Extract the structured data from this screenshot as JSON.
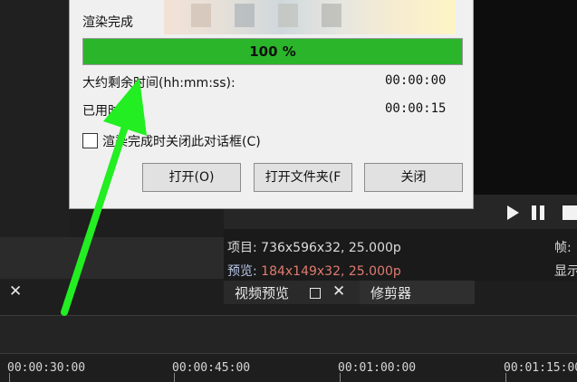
{
  "dialog": {
    "title": "渲染完成",
    "progress_percent": 100,
    "progress_text": "100 %",
    "remaining_label": "大约剩余时间(hh:mm:ss):",
    "remaining_value": "00:00:00",
    "elapsed_label": "已用时间",
    "elapsed_value": "00:00:15",
    "close_on_finish_label": "渲染完成时关闭此对话框(C)",
    "close_on_finish_checked": false,
    "buttons": {
      "open": "打开(O)",
      "open_folder": "打开文件夹(F",
      "close": "关闭"
    }
  },
  "preview": {
    "project_label": "项目:",
    "project_value": "736x596x32, 25.000p",
    "preview_label": "预览:",
    "preview_value": "184x149x32, 25.000p",
    "right_label_1": "帧:",
    "right_label_2": "显示"
  },
  "tabs": {
    "video_preview": "视频预览",
    "trimmer": "修剪器"
  },
  "timeline": {
    "ticks": [
      "00:00:30:00",
      "00:00:45:00",
      "00:01:00:00",
      "00:01:15:00"
    ]
  },
  "colors": {
    "progress_fill": "#2bb52b",
    "annotation_arrow": "#22ee22",
    "preview_value": "#e07b70"
  },
  "icons": {
    "play": "play-icon",
    "pause": "pause-icon",
    "stop": "stop-icon",
    "close": "close-icon",
    "undock": "window-icon"
  }
}
